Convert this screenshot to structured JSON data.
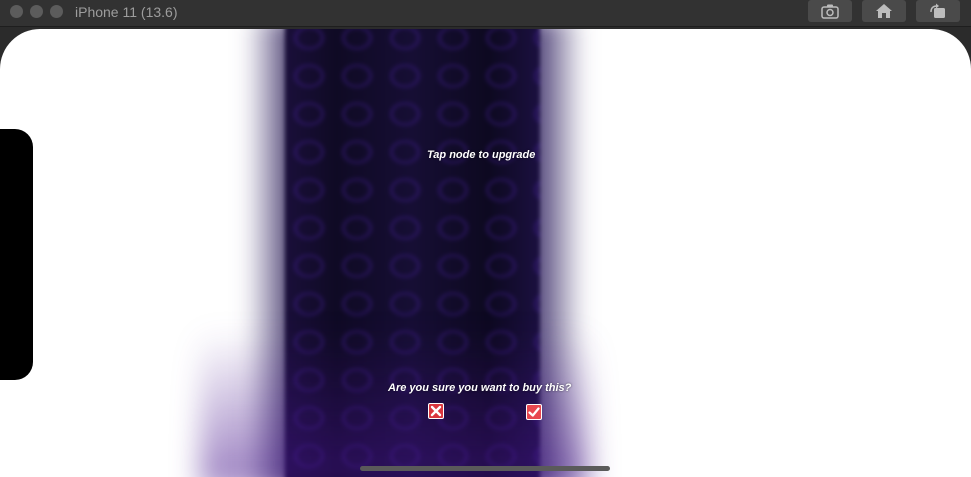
{
  "window": {
    "title": "iPhone 11 (13.6)"
  },
  "toolbar": {
    "buttons": [
      {
        "icon": "screenshot-icon"
      },
      {
        "icon": "home-icon"
      },
      {
        "icon": "rotate-icon"
      }
    ]
  },
  "game": {
    "hint": "Tap node to upgrade",
    "confirm_prompt": "Are you sure you want to buy this?",
    "cancel_icon": "close-icon",
    "confirm_icon": "checkmark-icon",
    "colors": {
      "background": "#160e34",
      "hex_grid": "#5a28c8",
      "cancel": "#d9363e",
      "confirm": "#e8474f"
    }
  }
}
